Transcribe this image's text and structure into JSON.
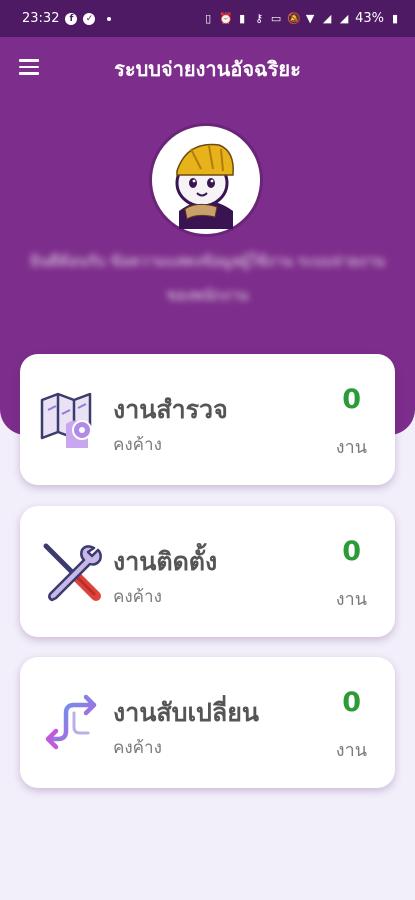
{
  "status_bar": {
    "time": "23:32",
    "battery": "43%"
  },
  "app": {
    "title": "ระบบจ่ายงานอัจฉริยะ",
    "menu_icon": "hamburger-menu-icon"
  },
  "profile": {
    "welcome_text": "ยินดีต้อนรับ ข้อความแสดงข้อมูลผู้ใช้งาน ระบบจ่ายงาน ของพนักงาน"
  },
  "cards": [
    {
      "title": "งานสำรวจ",
      "subtitle": "คงค้าง",
      "count": "0",
      "unit": "งาน",
      "icon": "survey-map-icon"
    },
    {
      "title": "งานติดตั้ง",
      "subtitle": "คงค้าง",
      "count": "0",
      "unit": "งาน",
      "icon": "install-tools-icon"
    },
    {
      "title": "งานสับเปลี่ยน",
      "subtitle": "คงค้าง",
      "count": "0",
      "unit": "งาน",
      "icon": "swap-arrows-icon"
    }
  ],
  "colors": {
    "primary": "#7d2d8b",
    "status_bar": "#4e1a63",
    "count_green": "#2a9b37",
    "background": "#f2eefa"
  }
}
